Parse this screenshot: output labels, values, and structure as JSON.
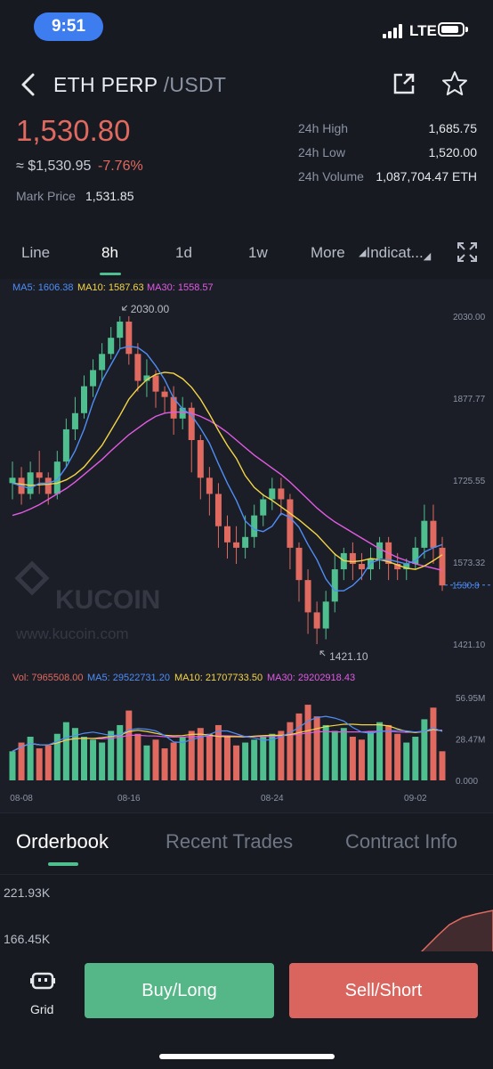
{
  "status_bar": {
    "time": "9:51",
    "network": "LTE"
  },
  "header": {
    "base": "ETH PERP",
    "quote": "/USDT"
  },
  "price": {
    "last": "1,530.80",
    "approx": "≈ $1,530.95",
    "change": "-7.76%",
    "mark_label": "Mark Price",
    "mark_value": "1,531.85"
  },
  "stats": [
    {
      "label": "24h High",
      "value": "1,685.75"
    },
    {
      "label": "24h Low",
      "value": "1,520.00"
    },
    {
      "label": "24h Volume",
      "value": "1,087,704.47 ETH"
    }
  ],
  "timeframes": {
    "line": "Line",
    "h8": "8h",
    "d1": "1d",
    "w1": "1w",
    "more": "More",
    "indicators": "Indicat..."
  },
  "ma_legend": {
    "ma5": "MA5: 1606.38",
    "ma10": "MA10: 1587.63",
    "ma30": "MA30: 1558.57"
  },
  "vol_legend": {
    "vol": "Vol: 7965508.00",
    "ma5": "MA5: 29522731.20",
    "ma10": "MA10: 21707733.50",
    "ma30": "MA30: 29202918.43"
  },
  "watermark": {
    "brand": "KUCOIN",
    "url": "www.kucoin.com"
  },
  "chart_data": {
    "type": "candlestick",
    "price_axis": [
      "2030.00",
      "1877.77",
      "1725.55",
      "1573.32",
      "1421.10"
    ],
    "price_ylim": [
      1421.1,
      2030.0
    ],
    "current_price_label": "1530.8",
    "current_price": 1530.8,
    "max_label": "2030.00",
    "min_label": "1421.10",
    "volume_axis": [
      "56.95M",
      "28.47M",
      "0.000"
    ],
    "volume_ylim": [
      0,
      56.95
    ],
    "x_ticks": [
      "08-08",
      "08-16",
      "08-24",
      "09-02"
    ],
    "x_tick_index": [
      1,
      13,
      29,
      45
    ],
    "colors": {
      "up": "#4fbf8f",
      "down": "#e06a60",
      "ma5": "#4f8ef7",
      "ma10": "#f5d547",
      "ma30": "#e15be3"
    },
    "candles": [
      [
        1720,
        1730,
        1690,
        1760
      ],
      [
        1730,
        1700,
        1680,
        1750
      ],
      [
        1700,
        1740,
        1690,
        1760
      ],
      [
        1740,
        1730,
        1700,
        1780
      ],
      [
        1730,
        1700,
        1680,
        1740
      ],
      [
        1700,
        1760,
        1690,
        1780
      ],
      [
        1760,
        1820,
        1750,
        1840
      ],
      [
        1820,
        1850,
        1800,
        1880
      ],
      [
        1850,
        1900,
        1840,
        1920
      ],
      [
        1900,
        1930,
        1880,
        1950
      ],
      [
        1930,
        1960,
        1910,
        1980
      ],
      [
        1960,
        1990,
        1950,
        2010
      ],
      [
        1990,
        2020,
        1970,
        2030
      ],
      [
        2020,
        1960,
        1940,
        2030
      ],
      [
        1960,
        1910,
        1890,
        1980
      ],
      [
        1910,
        1920,
        1880,
        1950
      ],
      [
        1920,
        1890,
        1860,
        1930
      ],
      [
        1890,
        1880,
        1850,
        1900
      ],
      [
        1880,
        1840,
        1810,
        1900
      ],
      [
        1840,
        1860,
        1820,
        1880
      ],
      [
        1860,
        1800,
        1740,
        1870
      ],
      [
        1800,
        1730,
        1690,
        1810
      ],
      [
        1730,
        1700,
        1660,
        1750
      ],
      [
        1700,
        1640,
        1600,
        1720
      ],
      [
        1640,
        1610,
        1580,
        1660
      ],
      [
        1610,
        1600,
        1570,
        1640
      ],
      [
        1600,
        1620,
        1580,
        1660
      ],
      [
        1620,
        1660,
        1600,
        1680
      ],
      [
        1660,
        1690,
        1640,
        1700
      ],
      [
        1690,
        1710,
        1670,
        1730
      ],
      [
        1710,
        1690,
        1660,
        1730
      ],
      [
        1690,
        1600,
        1560,
        1700
      ],
      [
        1600,
        1540,
        1500,
        1610
      ],
      [
        1540,
        1480,
        1440,
        1560
      ],
      [
        1480,
        1450,
        1421,
        1500
      ],
      [
        1450,
        1500,
        1430,
        1520
      ],
      [
        1500,
        1560,
        1480,
        1590
      ],
      [
        1560,
        1590,
        1540,
        1600
      ],
      [
        1590,
        1570,
        1540,
        1610
      ],
      [
        1570,
        1560,
        1540,
        1590
      ],
      [
        1560,
        1580,
        1540,
        1600
      ],
      [
        1580,
        1610,
        1560,
        1620
      ],
      [
        1610,
        1570,
        1540,
        1620
      ],
      [
        1570,
        1560,
        1540,
        1590
      ],
      [
        1560,
        1570,
        1540,
        1580
      ],
      [
        1570,
        1600,
        1560,
        1620
      ],
      [
        1600,
        1650,
        1580,
        1680
      ],
      [
        1650,
        1600,
        1570,
        1680
      ],
      [
        1600,
        1530,
        1520,
        1620
      ]
    ],
    "volume": [
      20,
      26,
      30,
      22,
      24,
      32,
      40,
      36,
      30,
      28,
      26,
      34,
      38,
      48,
      32,
      24,
      28,
      22,
      26,
      30,
      34,
      36,
      32,
      38,
      30,
      24,
      26,
      28,
      30,
      32,
      34,
      40,
      46,
      52,
      44,
      38,
      34,
      36,
      30,
      28,
      34,
      40,
      38,
      32,
      26,
      30,
      42,
      50,
      20
    ],
    "ma5": [
      1720,
      1715,
      1710,
      1720,
      1720,
      1726,
      1750,
      1780,
      1820,
      1870,
      1910,
      1940,
      1970,
      1974,
      1972,
      1960,
      1938,
      1912,
      1878,
      1858,
      1846,
      1822,
      1794,
      1756,
      1720,
      1688,
      1650,
      1634,
      1630,
      1640,
      1664,
      1656,
      1638,
      1606,
      1578,
      1542,
      1520,
      1520,
      1530,
      1546,
      1572,
      1578,
      1578,
      1574,
      1570,
      1576,
      1592,
      1600,
      1606
    ],
    "ma10": [
      1720,
      1718,
      1716,
      1717,
      1718,
      1720,
      1726,
      1736,
      1750,
      1770,
      1790,
      1818,
      1846,
      1876,
      1896,
      1912,
      1922,
      1926,
      1924,
      1914,
      1898,
      1876,
      1848,
      1818,
      1790,
      1766,
      1734,
      1712,
      1698,
      1688,
      1676,
      1664,
      1652,
      1638,
      1624,
      1606,
      1588,
      1576,
      1574,
      1576,
      1580,
      1578,
      1574,
      1568,
      1562,
      1560,
      1566,
      1576,
      1587
    ],
    "ma30": [
      1660,
      1665,
      1672,
      1680,
      1690,
      1700,
      1710,
      1722,
      1736,
      1750,
      1764,
      1780,
      1795,
      1810,
      1822,
      1834,
      1844,
      1850,
      1852,
      1852,
      1850,
      1844,
      1836,
      1826,
      1814,
      1800,
      1786,
      1772,
      1760,
      1748,
      1736,
      1722,
      1706,
      1690,
      1674,
      1660,
      1648,
      1638,
      1628,
      1618,
      1608,
      1598,
      1590,
      1582,
      1576,
      1570,
      1566,
      1562,
      1558
    ]
  },
  "bottom_tabs": {
    "orderbook": "Orderbook",
    "recent": "Recent Trades",
    "contract": "Contract Info"
  },
  "depth": {
    "label1": "221.93K",
    "label2": "166.45K"
  },
  "footer": {
    "grid_label": "Grid",
    "buy": "Buy/Long",
    "sell": "Sell/Short"
  }
}
